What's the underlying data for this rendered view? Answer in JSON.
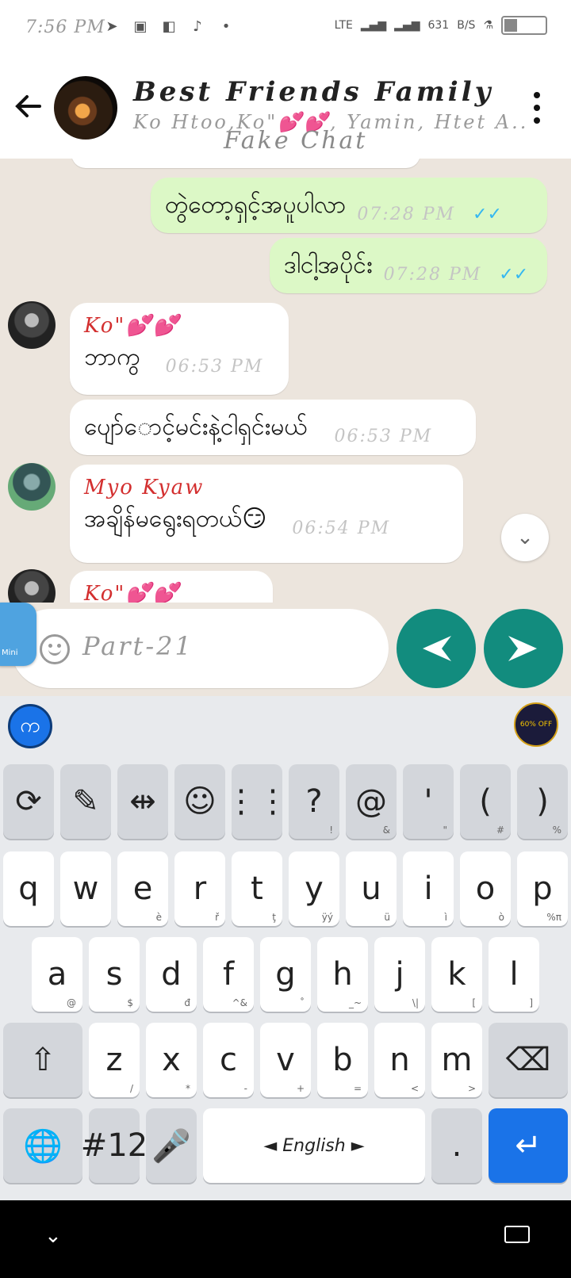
{
  "status_bar": {
    "time": "7:56 PM",
    "network": "LTE",
    "speed": "631",
    "speed_unit": "B/S"
  },
  "header": {
    "title": "Best Friends Family",
    "members": "Ko Htoo,Ko\"💕💕, Yamin, Htet A..",
    "watermark": "Fake Chat"
  },
  "messages": [
    {
      "side": "out",
      "text": "တွဲတော့ရှင့်အပူပါလာ",
      "time": "07:28 PM",
      "ticks": "✓✓"
    },
    {
      "side": "out",
      "text": "ဒါငါ့အပိုင်း",
      "time": "07:28 PM",
      "ticks": "✓✓"
    },
    {
      "side": "in",
      "sender": "Ko\"💕💕",
      "text": "ဘာကွ",
      "time": "06:53 PM"
    },
    {
      "side": "in",
      "text": "ပျော်ောင့်မင်းနဲ့ငါရှင်းမယ်",
      "time": "06:53 PM"
    },
    {
      "side": "in",
      "sender": "Myo Kyaw",
      "text": "အချိန်မရွေးရတယ်😏",
      "time": "06:54 PM"
    },
    {
      "side": "in",
      "sender": "Ko\"💕💕",
      "text": "",
      "time": ""
    }
  ],
  "input": {
    "value": "Part-21",
    "mini_label": "Mini"
  },
  "keyboard": {
    "badge": " က",
    "ad_text": "60% OFF",
    "row_fn": [
      {
        "label": "⟳",
        "icon": "sync-icon"
      },
      {
        "label": "✎",
        "icon": "sticker-icon"
      },
      {
        "label": "⇹",
        "icon": "cursor-move-icon"
      },
      {
        "label": "☺",
        "icon": "emoji-icon"
      },
      {
        "label": "⋮⋮",
        "icon": "numpad-icon"
      },
      {
        "label": "?",
        "sub": "!"
      },
      {
        "label": "@",
        "sub": "&"
      },
      {
        "label": "'",
        "sub": "\""
      },
      {
        "label": "(",
        "sub": "#"
      },
      {
        "label": ")",
        "sub": "%"
      }
    ],
    "row1": [
      {
        "label": "q"
      },
      {
        "label": "w"
      },
      {
        "label": "e",
        "sub": "è"
      },
      {
        "label": "r",
        "sub": "ř"
      },
      {
        "label": "t",
        "sub": "ţ"
      },
      {
        "label": "y",
        "sub": "ÿý"
      },
      {
        "label": "u",
        "sub": "ü"
      },
      {
        "label": "i",
        "sub": "ì"
      },
      {
        "label": "o",
        "sub": "ò"
      },
      {
        "label": "p",
        "sub": "%π"
      }
    ],
    "row2": [
      {
        "label": "a",
        "sub": "@"
      },
      {
        "label": "s",
        "sub": "$"
      },
      {
        "label": "d",
        "sub": "đ"
      },
      {
        "label": "f",
        "sub": "^&"
      },
      {
        "label": "g",
        "sub": "˚"
      },
      {
        "label": "h",
        "sub": "_~"
      },
      {
        "label": "j",
        "sub": "\\|"
      },
      {
        "label": "k",
        "sub": "["
      },
      {
        "label": "l",
        "sub": "]"
      }
    ],
    "row3": [
      {
        "label": "z",
        "sub": "/"
      },
      {
        "label": "x",
        "sub": "*"
      },
      {
        "label": "c",
        "sub": "-"
      },
      {
        "label": "v",
        "sub": "+"
      },
      {
        "label": "b",
        "sub": "="
      },
      {
        "label": "n",
        "sub": "<"
      },
      {
        "label": "m",
        "sub": ">"
      }
    ],
    "symbols_label": "#12",
    "space_label": "◄ English ►",
    "period_label": "."
  }
}
